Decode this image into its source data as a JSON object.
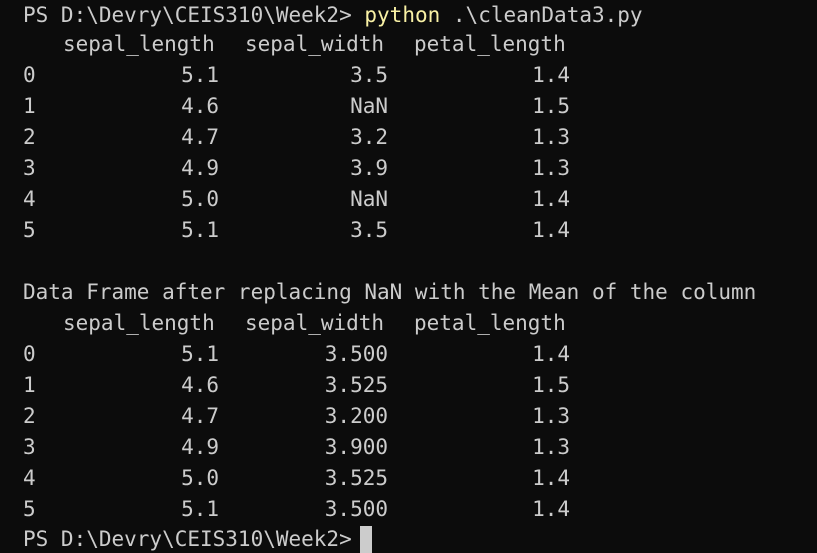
{
  "colors": {
    "background": "#0c0c0c",
    "text": "#cccccc",
    "command": "#f9f1a5"
  },
  "prompt": "PS D:\\Devry\\CEIS310\\Week2>",
  "command_name": "python",
  "command_args": ".\\cleanData3.py",
  "table1": {
    "headers": [
      "sepal_length",
      "sepal_width",
      "petal_length"
    ],
    "rows": [
      {
        "index": "0",
        "sepal_length": "5.1",
        "sepal_width": "3.5",
        "petal_length": "1.4"
      },
      {
        "index": "1",
        "sepal_length": "4.6",
        "sepal_width": "NaN",
        "petal_length": "1.5"
      },
      {
        "index": "2",
        "sepal_length": "4.7",
        "sepal_width": "3.2",
        "petal_length": "1.3"
      },
      {
        "index": "3",
        "sepal_length": "4.9",
        "sepal_width": "3.9",
        "petal_length": "1.3"
      },
      {
        "index": "4",
        "sepal_length": "5.0",
        "sepal_width": "NaN",
        "petal_length": "1.4"
      },
      {
        "index": "5",
        "sepal_length": "5.1",
        "sepal_width": "3.5",
        "petal_length": "1.4"
      }
    ]
  },
  "message": "Data Frame after replacing NaN with the Mean of the column",
  "table2": {
    "headers": [
      "sepal_length",
      "sepal_width",
      "petal_length"
    ],
    "rows": [
      {
        "index": "0",
        "sepal_length": "5.1",
        "sepal_width": "3.500",
        "petal_length": "1.4"
      },
      {
        "index": "1",
        "sepal_length": "4.6",
        "sepal_width": "3.525",
        "petal_length": "1.5"
      },
      {
        "index": "2",
        "sepal_length": "4.7",
        "sepal_width": "3.200",
        "petal_length": "1.3"
      },
      {
        "index": "3",
        "sepal_length": "4.9",
        "sepal_width": "3.900",
        "petal_length": "1.3"
      },
      {
        "index": "4",
        "sepal_length": "5.0",
        "sepal_width": "3.525",
        "petal_length": "1.4"
      },
      {
        "index": "5",
        "sepal_length": "5.1",
        "sepal_width": "3.500",
        "petal_length": "1.4"
      }
    ]
  },
  "final_prompt": "PS D:\\Devry\\CEIS310\\Week2>"
}
